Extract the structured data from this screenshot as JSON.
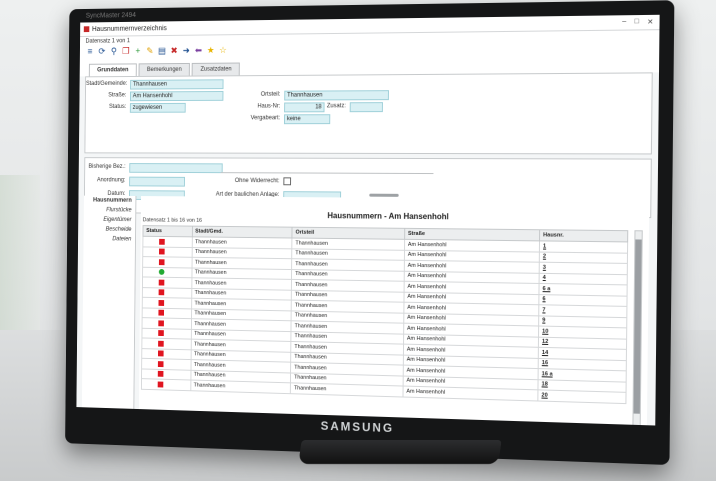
{
  "monitor": {
    "brand": "SAMSUNG",
    "topbar_text": "SyncMaster 2494"
  },
  "window": {
    "title": "Hausnummernverzeichnis",
    "record_top": "Datensatz 1 von 1",
    "controls": [
      "–",
      "□",
      "✕"
    ]
  },
  "toolbar": {
    "icons": [
      "menu-icon",
      "refresh-icon",
      "search-icon",
      "copy-icon",
      "add-icon",
      "edit-icon",
      "document-icon",
      "delete-icon",
      "forward-icon",
      "back-icon",
      "star-icon",
      "star-outline-icon"
    ]
  },
  "tabs": [
    {
      "label": "Grunddaten",
      "active": true
    },
    {
      "label": "Bemerkungen",
      "active": false
    },
    {
      "label": "Zusatzdaten",
      "active": false
    }
  ],
  "form": {
    "stadt_label": "Stadt/Gemeinde:",
    "stadt_value": "Thannhausen",
    "strasse_label": "Straße:",
    "strasse_value": "Am Hansenhohl",
    "status_label": "Status:",
    "status_value": "zugewiesen",
    "ortsteil_label": "Ortsteil:",
    "ortsteil_value": "Thannhausen",
    "hausnr_label": "Haus-Nr:",
    "hausnr_value": "18",
    "zusatz_label": "Zusatz:",
    "zusatz_value": "",
    "vergabe_label": "Vergabeart:",
    "vergabe_value": "keine"
  },
  "form2": {
    "bisher_label": "Bisherige Bez.:",
    "bisher_value": "",
    "anordnung_label": "Anordnung:",
    "anordnung_value": "",
    "datum_label": "Datum:",
    "datum_value": "",
    "ohne_label": "Ohne Widerrecht:",
    "art_label": "Art der baulichen Anlage:",
    "art_value": ""
  },
  "nav": {
    "items": [
      {
        "label": "Hausnummern",
        "active": true
      },
      {
        "label": "Flurstücke",
        "active": false
      },
      {
        "label": "Eigentümer",
        "active": false
      },
      {
        "label": "Bescheide",
        "active": false
      },
      {
        "label": "Dateien",
        "active": false
      }
    ]
  },
  "list": {
    "title": "Hausnummern - Am Hansenhohl",
    "count": "Datensatz 1 bis 16 von 16",
    "columns": [
      "Status",
      "Stadt/Gmd.",
      "Ortsteil",
      "Straße",
      "Hausnr."
    ],
    "rows": [
      {
        "status": "red",
        "stadt": "Thannhausen",
        "ortsteil": "Thannhausen",
        "strasse": "Am Hansenhohl",
        "hausnr": "1"
      },
      {
        "status": "red",
        "stadt": "Thannhausen",
        "ortsteil": "Thannhausen",
        "strasse": "Am Hansenhohl",
        "hausnr": "2"
      },
      {
        "status": "red",
        "stadt": "Thannhausen",
        "ortsteil": "Thannhausen",
        "strasse": "Am Hansenhohl",
        "hausnr": "3"
      },
      {
        "status": "green",
        "stadt": "Thannhausen",
        "ortsteil": "Thannhausen",
        "strasse": "Am Hansenhohl",
        "hausnr": "4"
      },
      {
        "status": "red",
        "stadt": "Thannhausen",
        "ortsteil": "Thannhausen",
        "strasse": "Am Hansenhohl",
        "hausnr": "6 a"
      },
      {
        "status": "red",
        "stadt": "Thannhausen",
        "ortsteil": "Thannhausen",
        "strasse": "Am Hansenhohl",
        "hausnr": "6"
      },
      {
        "status": "red",
        "stadt": "Thannhausen",
        "ortsteil": "Thannhausen",
        "strasse": "Am Hansenhohl",
        "hausnr": "7"
      },
      {
        "status": "red",
        "stadt": "Thannhausen",
        "ortsteil": "Thannhausen",
        "strasse": "Am Hansenhohl",
        "hausnr": "9"
      },
      {
        "status": "red",
        "stadt": "Thannhausen",
        "ortsteil": "Thannhausen",
        "strasse": "Am Hansenhohl",
        "hausnr": "10"
      },
      {
        "status": "red",
        "stadt": "Thannhausen",
        "ortsteil": "Thannhausen",
        "strasse": "Am Hansenhohl",
        "hausnr": "12"
      },
      {
        "status": "red",
        "stadt": "Thannhausen",
        "ortsteil": "Thannhausen",
        "strasse": "Am Hansenhohl",
        "hausnr": "14"
      },
      {
        "status": "red",
        "stadt": "Thannhausen",
        "ortsteil": "Thannhausen",
        "strasse": "Am Hansenhohl",
        "hausnr": "16"
      },
      {
        "status": "red",
        "stadt": "Thannhausen",
        "ortsteil": "Thannhausen",
        "strasse": "Am Hansenhohl",
        "hausnr": "16 a"
      },
      {
        "status": "red",
        "stadt": "Thannhausen",
        "ortsteil": "Thannhausen",
        "strasse": "Am Hansenhohl",
        "hausnr": "18"
      },
      {
        "status": "red",
        "stadt": "Thannhausen",
        "ortsteil": "Thannhausen",
        "strasse": "Am Hansenhohl",
        "hausnr": "20"
      }
    ]
  },
  "colors": {
    "status_red": "#e01520",
    "status_green": "#22aa33",
    "field_bg": "#d9f0f4"
  }
}
